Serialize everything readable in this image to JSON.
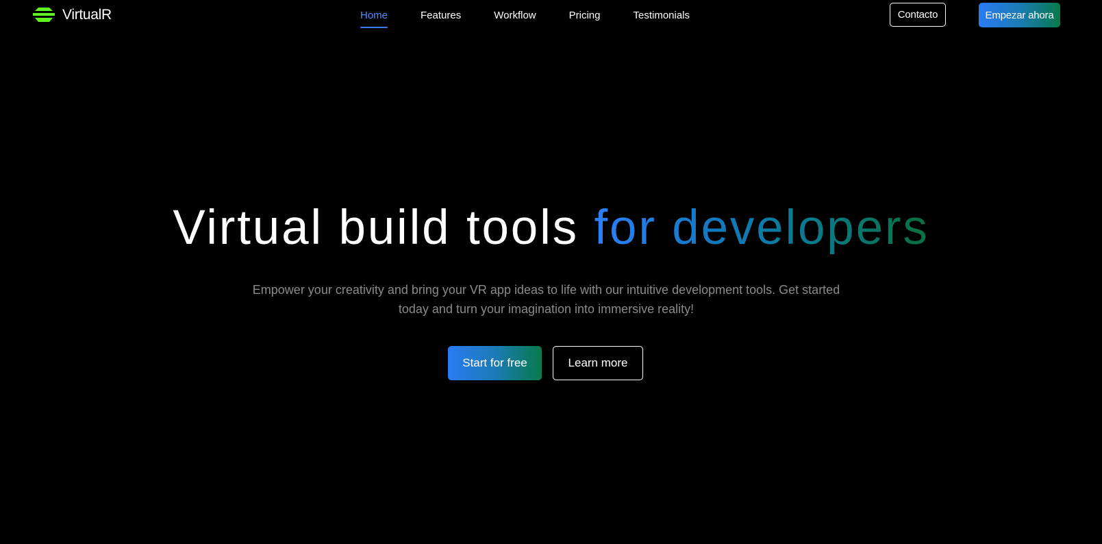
{
  "header": {
    "brand": {
      "name": "VirtualR",
      "logo_icon": "stacked-layers-logo-icon",
      "logo_color": "#5cf31f"
    },
    "nav": [
      {
        "label": "Home",
        "active": true
      },
      {
        "label": "Features",
        "active": false
      },
      {
        "label": "Workflow",
        "active": false
      },
      {
        "label": "Pricing",
        "active": false
      },
      {
        "label": "Testimonials",
        "active": false
      }
    ],
    "contact_label": "Contacto",
    "start_now_label": "Empezar ahora"
  },
  "hero": {
    "title_plain": "Virtual build tools",
    "title_gradient": "for developers",
    "description": "Empower your creativity and bring your VR app ideas to life with our intuitive development tools. Get started today and turn your imagination into immersive reality!",
    "primary_cta": "Start for free",
    "secondary_cta": "Learn more"
  },
  "colors": {
    "background": "#000000",
    "text": "#ffffff",
    "muted_text": "#8a8a8a",
    "active_nav": "#4f8dfd",
    "gradient_start": "#2a7bf3",
    "gradient_end": "#087a4a",
    "logo": "#5cf31f"
  }
}
